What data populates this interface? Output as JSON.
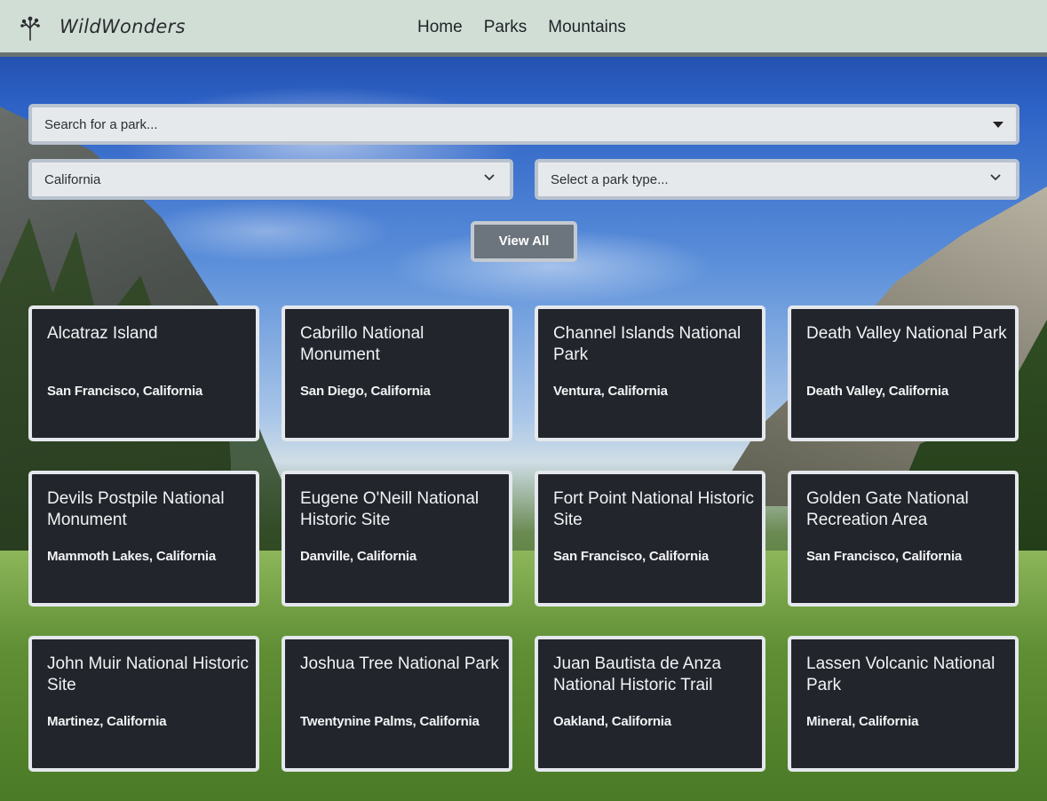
{
  "header": {
    "brand": "WildWonders",
    "nav": [
      "Home",
      "Parks",
      "Mountains"
    ]
  },
  "search": {
    "placeholder": "Search for a park..."
  },
  "filters": {
    "state_value": "California",
    "type_placeholder": "Select a park type..."
  },
  "view_all_label": "View All",
  "parks": [
    {
      "name": "Alcatraz Island",
      "location": "San Francisco, California"
    },
    {
      "name": "Cabrillo National Monument",
      "location": "San Diego, California"
    },
    {
      "name": "Channel Islands National Park",
      "location": "Ventura, California"
    },
    {
      "name": "Death Valley National Park",
      "location": "Death Valley, California"
    },
    {
      "name": "Devils Postpile National Monument",
      "location": "Mammoth Lakes, California"
    },
    {
      "name": "Eugene O'Neill National Historic Site",
      "location": "Danville, California"
    },
    {
      "name": "Fort Point National Historic Site",
      "location": "San Francisco, California"
    },
    {
      "name": "Golden Gate National Recreation Area",
      "location": "San Francisco, California"
    },
    {
      "name": "John Muir National Historic Site",
      "location": "Martinez, California"
    },
    {
      "name": "Joshua Tree National Park",
      "location": "Twentynine Palms, California"
    },
    {
      "name": "Juan Bautista de Anza National Historic Trail",
      "location": "Oakland, California"
    },
    {
      "name": "Lassen Volcanic National Park",
      "location": "Mineral, California"
    }
  ],
  "colors": {
    "header_bg": "#d1ded6",
    "card_bg": "#22252b",
    "button_bg": "#6c757d"
  }
}
